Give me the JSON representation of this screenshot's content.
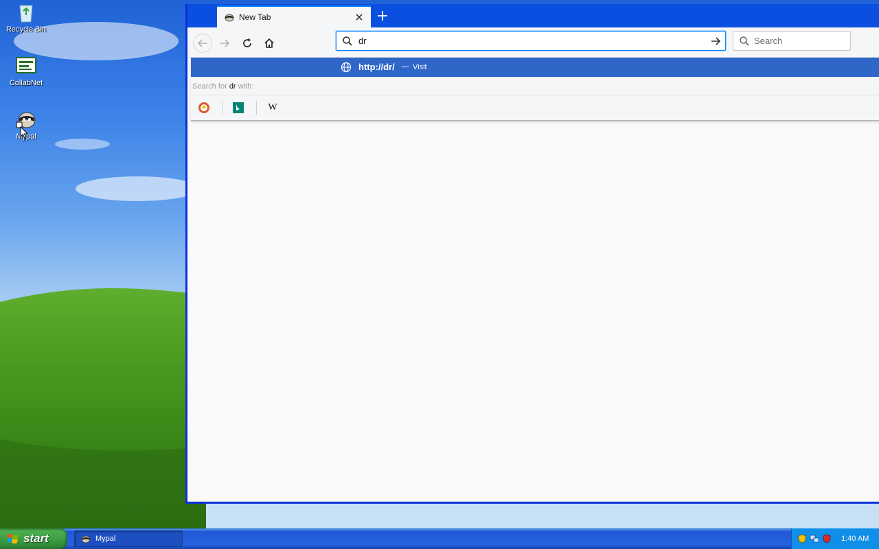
{
  "desktop": {
    "icons": [
      {
        "label": "Recycle Bin",
        "icon": "recycle-bin-icon"
      },
      {
        "label": "CollabNet",
        "icon": "collabnet-icon"
      },
      {
        "label": "Mypal",
        "icon": "mypal-icon"
      }
    ]
  },
  "browser": {
    "tab": {
      "title": "New Tab",
      "favicon": "mypal-favicon-icon"
    },
    "urlbar": {
      "value": "dr"
    },
    "searchbar": {
      "placeholder": "Search"
    },
    "popup": {
      "suggestion": {
        "url": "http://dr/",
        "separator": "—",
        "action": "Visit"
      },
      "search_with": {
        "prefix": "Search for",
        "query": "dr",
        "suffix": "with:"
      },
      "engines": [
        "duckduckgo-icon",
        "bing-icon",
        "wikipedia-icon"
      ],
      "wikipedia_glyph": "W"
    }
  },
  "taskbar": {
    "start_label": "start",
    "tasks": [
      {
        "label": "Mypal",
        "icon": "mypal-icon"
      }
    ],
    "clock": "1:40 AM"
  },
  "colors": {
    "accent": "#0a84ff",
    "selection": "#2f67c9",
    "titlebar": "#0a4fe0",
    "taskbar": "#2663e0",
    "start": "#3a9a3f"
  }
}
